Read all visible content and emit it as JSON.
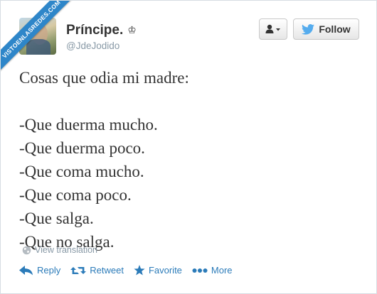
{
  "watermark": {
    "text": "VISTOENLASREDES.COM"
  },
  "user": {
    "name": "Príncipe.",
    "badge": "♔",
    "handle": "@JdeJodido"
  },
  "buttons": {
    "user_menu_icon": "person-dropdown-icon",
    "follow_label": "Follow"
  },
  "tweet": {
    "lines": [
      "Cosas que odia mi madre:",
      "",
      "-Que duerma mucho.",
      "-Que duerma poco.",
      "-Que coma mucho.",
      "-Que coma poco.",
      "-Que salga.",
      "-Que no salga."
    ]
  },
  "translation": {
    "label": "View translation"
  },
  "actions": [
    {
      "label": "Reply",
      "icon": "reply-icon"
    },
    {
      "label": "Retweet",
      "icon": "retweet-icon"
    },
    {
      "label": "Favorite",
      "icon": "star-icon"
    },
    {
      "label": "More",
      "icon": "more-dots-icon"
    }
  ],
  "colors": {
    "accent": "#2b7bb9",
    "text": "#333333",
    "muted": "#8899a6",
    "twitter_bird": "#55acee",
    "ribbon": "#2e86c9"
  }
}
